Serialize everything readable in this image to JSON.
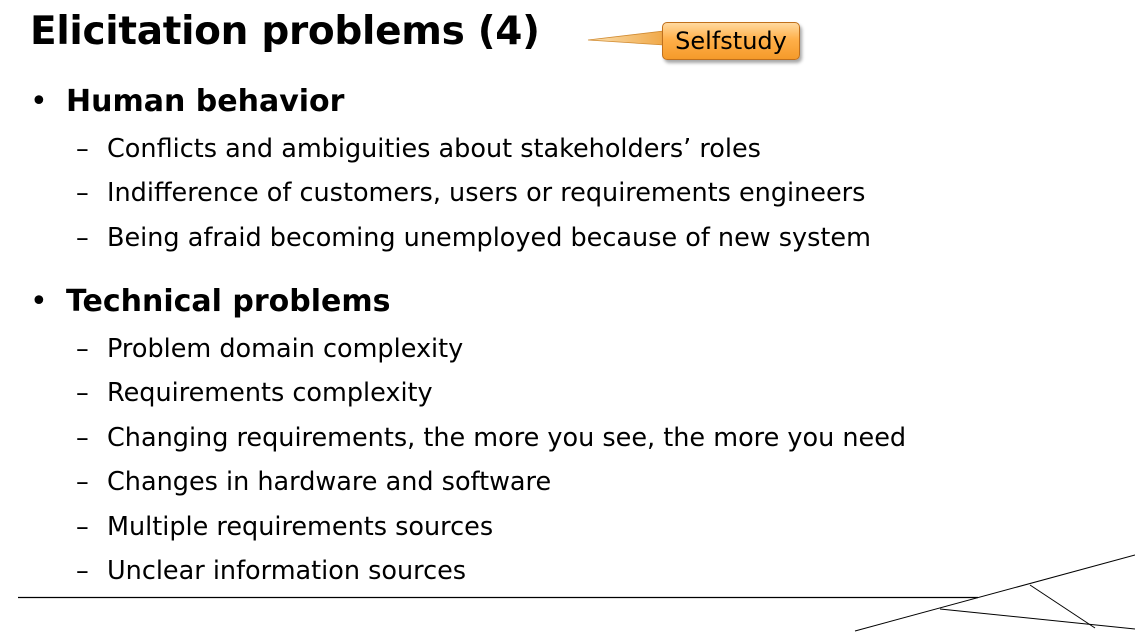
{
  "slide": {
    "title": "Elicitation problems (4)",
    "badge": "Selfstudy",
    "sections": [
      {
        "heading": "Human behavior",
        "items": [
          "Conflicts and ambiguities about stakeholders’ roles",
          "Indifference of customers, users or requirements engineers",
          "Being afraid becoming unemployed because of new system"
        ]
      },
      {
        "heading": "Technical problems",
        "items": [
          "Problem domain complexity",
          "Requirements complexity",
          "Changing requirements, the more you see, the more you need",
          "Changes in hardware and software",
          "Multiple requirements sources",
          "Unclear information sources"
        ]
      }
    ],
    "bullet_symbol": "•",
    "dash_symbol": "–"
  },
  "colors": {
    "badge_fill": "#ffb04a",
    "badge_border": "#c0701c",
    "tail": "#f0a848",
    "rule": "#000000"
  }
}
